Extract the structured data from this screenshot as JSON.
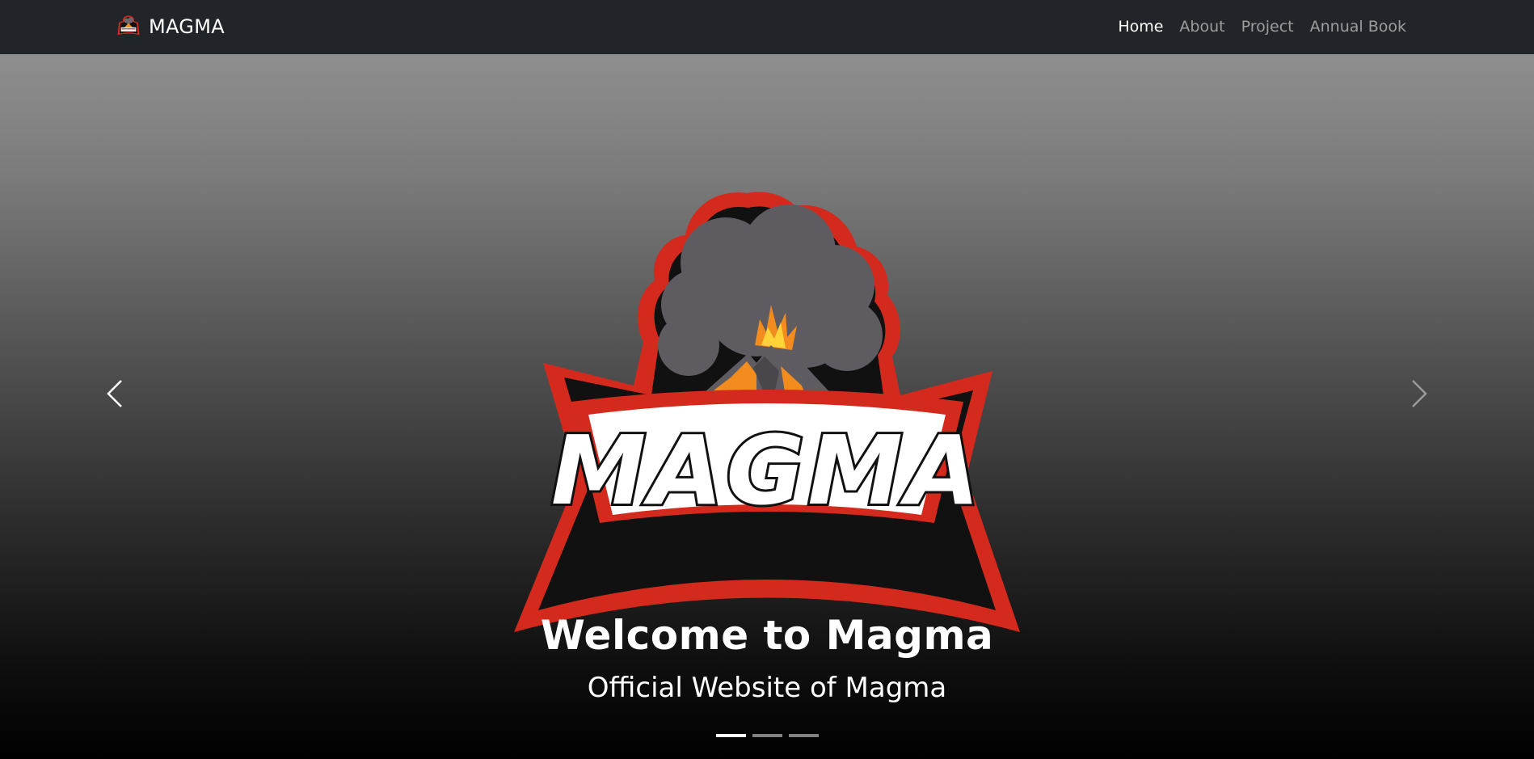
{
  "navbar": {
    "brand": {
      "text": "MAGMA",
      "logo_icon": "magma-volcano-logo-icon"
    },
    "links": [
      {
        "label": "Home",
        "active": true
      },
      {
        "label": "About",
        "active": false
      },
      {
        "label": "Project",
        "active": false
      },
      {
        "label": "Annual Book",
        "active": false
      }
    ]
  },
  "carousel": {
    "slide": {
      "logo_icon": "magma-volcano-logo-icon",
      "logo_text": "MAGMA",
      "title": "Welcome to Magma",
      "subtitle": "Official Website of Magma"
    },
    "prev_icon": "chevron-left-icon",
    "next_icon": "chevron-right-icon",
    "indicators": {
      "count": 3,
      "active_index": 0
    }
  },
  "colors": {
    "navbar_bg": "#212529",
    "logo_red": "#d42a1e",
    "logo_dark": "#111111",
    "smoke_gray": "#5f5c61",
    "lava_orange": "#f28c1f"
  }
}
